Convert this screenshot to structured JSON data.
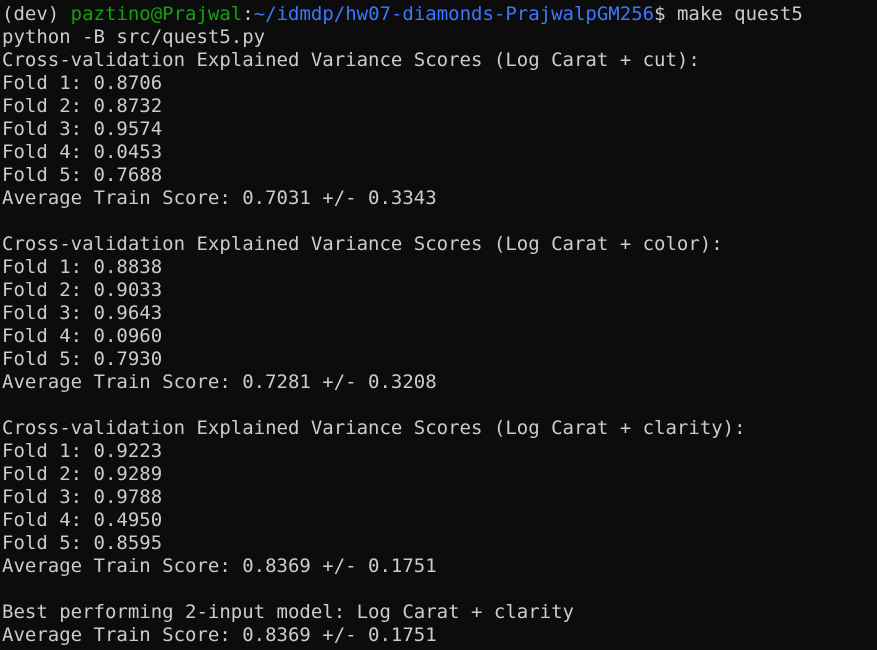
{
  "prompt": {
    "env": "(dev)",
    "user_host": "paztino@Prajwal",
    "separator": ":",
    "path": "~/idmdp/hw07-diamonds-PrajwalpGM256",
    "symbol": "$",
    "command": "make quest5"
  },
  "lines": {
    "cmd_echo": "python -B src/quest5.py",
    "cut": {
      "header": "Cross-validation Explained Variance Scores (Log Carat + cut):",
      "fold1": "Fold 1: 0.8706",
      "fold2": "Fold 2: 0.8732",
      "fold3": "Fold 3: 0.9574",
      "fold4": "Fold 4: 0.0453",
      "fold5": "Fold 5: 0.7688",
      "average": "Average Train Score: 0.7031 +/- 0.3343"
    },
    "color": {
      "header": "Cross-validation Explained Variance Scores (Log Carat + color):",
      "fold1": "Fold 1: 0.8838",
      "fold2": "Fold 2: 0.9033",
      "fold3": "Fold 3: 0.9643",
      "fold4": "Fold 4: 0.0960",
      "fold5": "Fold 5: 0.7930",
      "average": "Average Train Score: 0.7281 +/- 0.3208"
    },
    "clarity": {
      "header": "Cross-validation Explained Variance Scores (Log Carat + clarity):",
      "fold1": "Fold 1: 0.9223",
      "fold2": "Fold 2: 0.9289",
      "fold3": "Fold 3: 0.9788",
      "fold4": "Fold 4: 0.4950",
      "fold5": "Fold 5: 0.8595",
      "average": "Average Train Score: 0.8369 +/- 0.1751"
    },
    "best_model": "Best performing 2-input model: Log Carat + clarity",
    "best_average": "Average Train Score: 0.8369 +/- 0.1751"
  },
  "colors": {
    "background": "#0c0c0c",
    "text": "#cccccc",
    "user_host": "#13a10e",
    "path": "#3b78ff"
  }
}
